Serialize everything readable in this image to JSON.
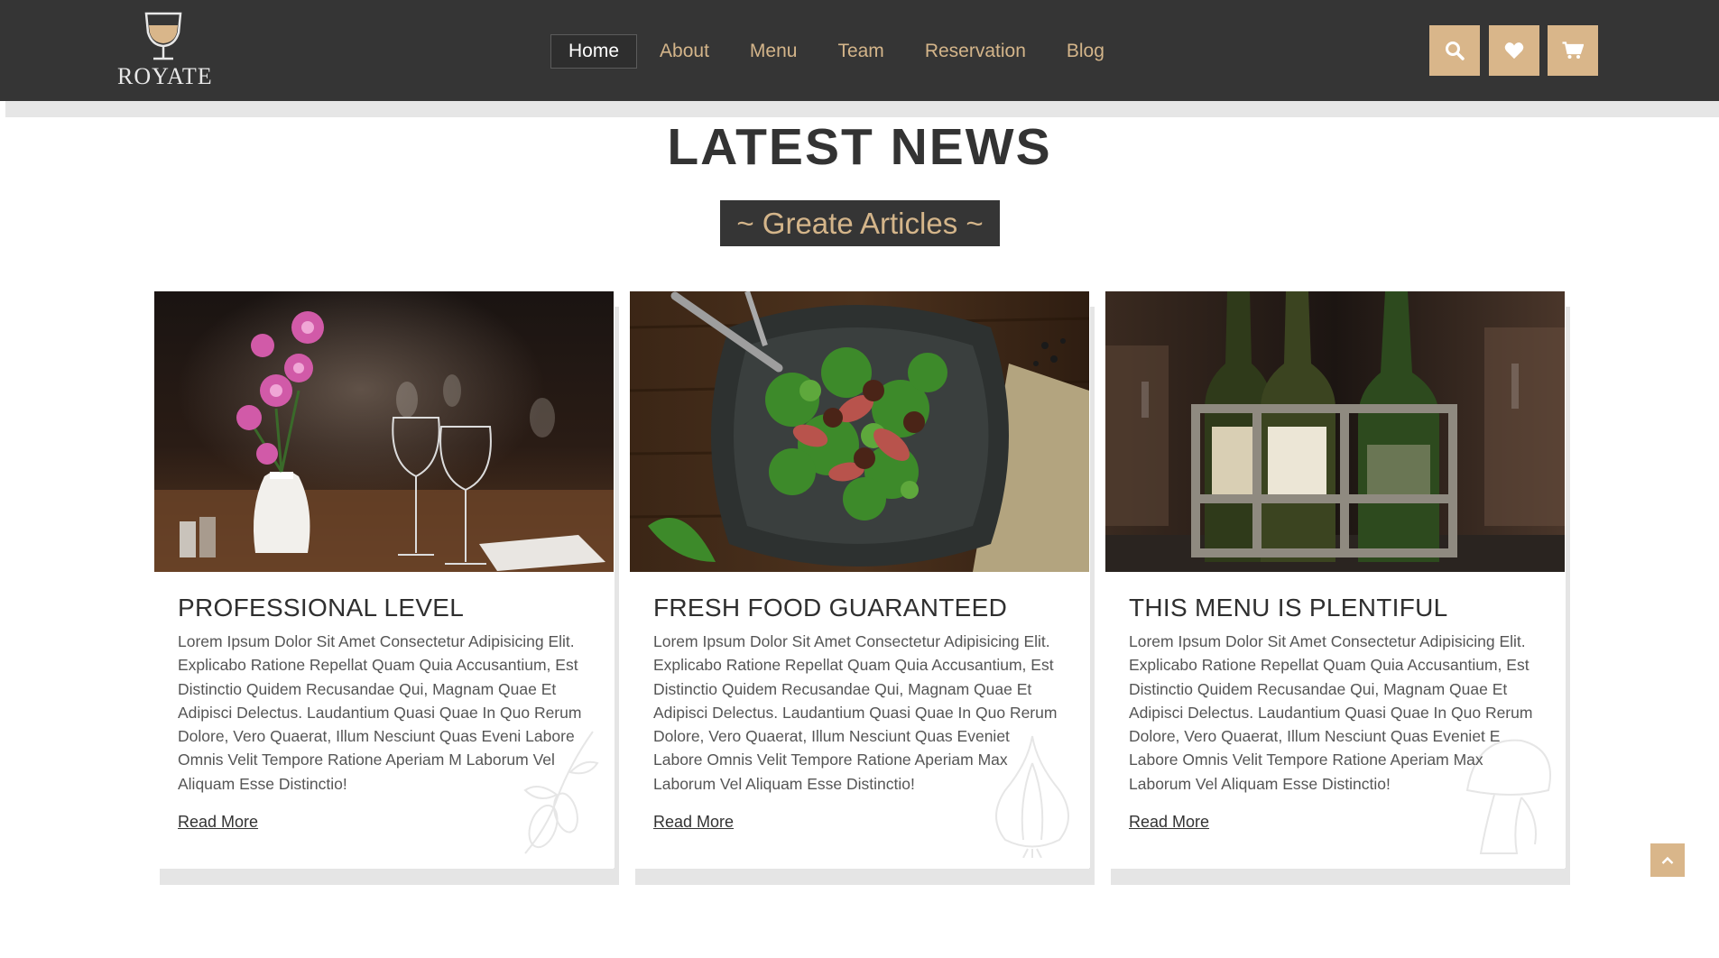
{
  "brand": {
    "name": "ROYATE",
    "logo_icon": "wine-glass-icon"
  },
  "nav": {
    "items": [
      {
        "label": "Home",
        "active": true
      },
      {
        "label": "About",
        "active": false
      },
      {
        "label": "Menu",
        "active": false
      },
      {
        "label": "Team",
        "active": false
      },
      {
        "label": "Reservation",
        "active": false
      },
      {
        "label": "Blog",
        "active": false
      }
    ]
  },
  "header_actions": [
    "search-icon",
    "heart-icon",
    "cart-icon"
  ],
  "colors": {
    "header_bg": "#353535",
    "accent": "#d9b68a",
    "accent_text": "#d4b58a"
  },
  "section": {
    "title": "LATEST NEWS",
    "subtitle": "~ Greate Articles ~"
  },
  "cards": [
    {
      "image": "restaurant-table-flowers-image",
      "title": "PROFESSIONAL LEVEL",
      "text": "Lorem Ipsum Dolor Sit Amet Consectetur Adipisicing Elit. Explicabo Ratione Repellat Quam Quia Accusantium, Est Distinctio Quidem Recusandae Qui, Magnam Quae Et Adipisci Delectus. Laudantium Quasi Quae In Quo Rerum Dolore, Vero Quaerat, Illum Nesciunt Quas Eveni Labore Omnis Velit Tempore Ratione Aperiam M Laborum Vel Aliquam Esse Distinctio!",
      "link": "Read More",
      "decoration": "olive-branch-icon"
    },
    {
      "image": "salad-plate-image",
      "title": "FRESH FOOD GUARANTEED",
      "text": "Lorem Ipsum Dolor Sit Amet Consectetur Adipisicing Elit. Explicabo Ratione Repellat Quam Quia Accusantium, Est Distinctio Quidem Recusandae Qui, Magnam Quae Et Adipisci Delectus. Laudantium Quasi Quae In Quo Rerum Dolore, Vero Quaerat, Illum Nesciunt Quas Eveniet Labore Omnis Velit Tempore Ratione Aperiam Max Laborum Vel Aliquam Esse Distinctio!",
      "link": "Read More",
      "decoration": "garlic-icon"
    },
    {
      "image": "wine-bottles-image",
      "title": "THIS MENU IS PLENTIFUL",
      "text": "Lorem Ipsum Dolor Sit Amet Consectetur Adipisicing Elit. Explicabo Ratione Repellat Quam Quia Accusantium, Est Distinctio Quidem Recusandae Qui, Magnam Quae Et Adipisci Delectus. Laudantium Quasi Quae In Quo Rerum Dolore, Vero Quaerat, Illum Nesciunt Quas Eveniet E Labore Omnis Velit Tempore Ratione Aperiam Max Laborum Vel Aliquam Esse Distinctio!",
      "link": "Read More",
      "decoration": "mushroom-icon"
    }
  ],
  "back_to_top_icon": "chevron-up-icon"
}
